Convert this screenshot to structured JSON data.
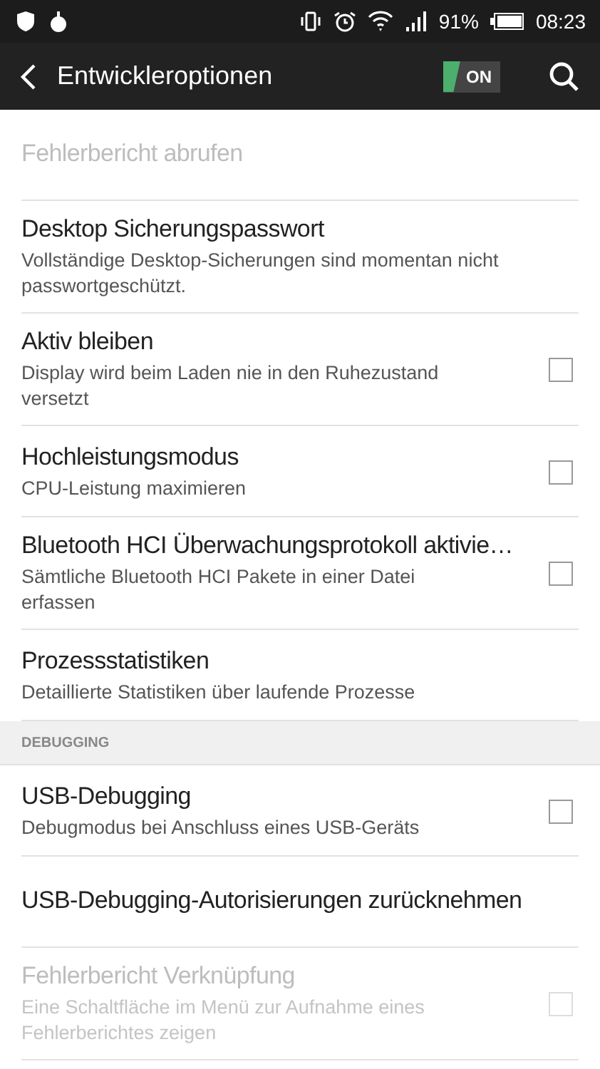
{
  "status_bar": {
    "battery": "91%",
    "time": "08:23"
  },
  "app_bar": {
    "title": "Entwickleroptionen",
    "toggle": {
      "label": "ON",
      "on": true
    }
  },
  "sections": [
    {
      "items": [
        {
          "kind": "action",
          "title": "Fehlerbericht abrufen",
          "disabled": true
        },
        {
          "kind": "action",
          "title": "Desktop Sicherungspasswort",
          "summary": "Vollständige Desktop-Sicherungen sind momentan nicht passwortgeschützt.",
          "disabled": false
        },
        {
          "kind": "checkbox",
          "title": "Aktiv bleiben",
          "summary": "Display wird beim Laden nie in den Ruhezustand versetzt",
          "disabled": false,
          "checked": false
        },
        {
          "kind": "checkbox",
          "title": "Hochleistungsmodus",
          "summary": "CPU-Leistung maximieren",
          "disabled": false,
          "checked": false
        },
        {
          "kind": "checkbox",
          "title": "Bluetooth HCI Überwachungsprotokoll aktivie…",
          "summary": "Sämtliche Bluetooth HCI Pakete in einer Datei erfassen",
          "disabled": false,
          "checked": false
        },
        {
          "kind": "action",
          "title": "Prozessstatistiken",
          "summary": "Detaillierte Statistiken über laufende Prozesse",
          "disabled": false
        }
      ]
    },
    {
      "header": "DEBUGGING",
      "items": [
        {
          "kind": "checkbox",
          "title": "USB-Debugging",
          "summary": "Debugmodus bei Anschluss eines USB-Geräts",
          "disabled": false,
          "checked": false
        },
        {
          "kind": "action",
          "title": "USB-Debugging-Autorisierungen zurücknehmen",
          "disabled": false
        },
        {
          "kind": "checkbox",
          "title": "Fehlerbericht Verknüpfung",
          "summary": "Eine Schaltfläche im Menü zur Aufnahme eines Fehlerberichtes zeigen",
          "disabled": true,
          "checked": false
        }
      ]
    }
  ]
}
